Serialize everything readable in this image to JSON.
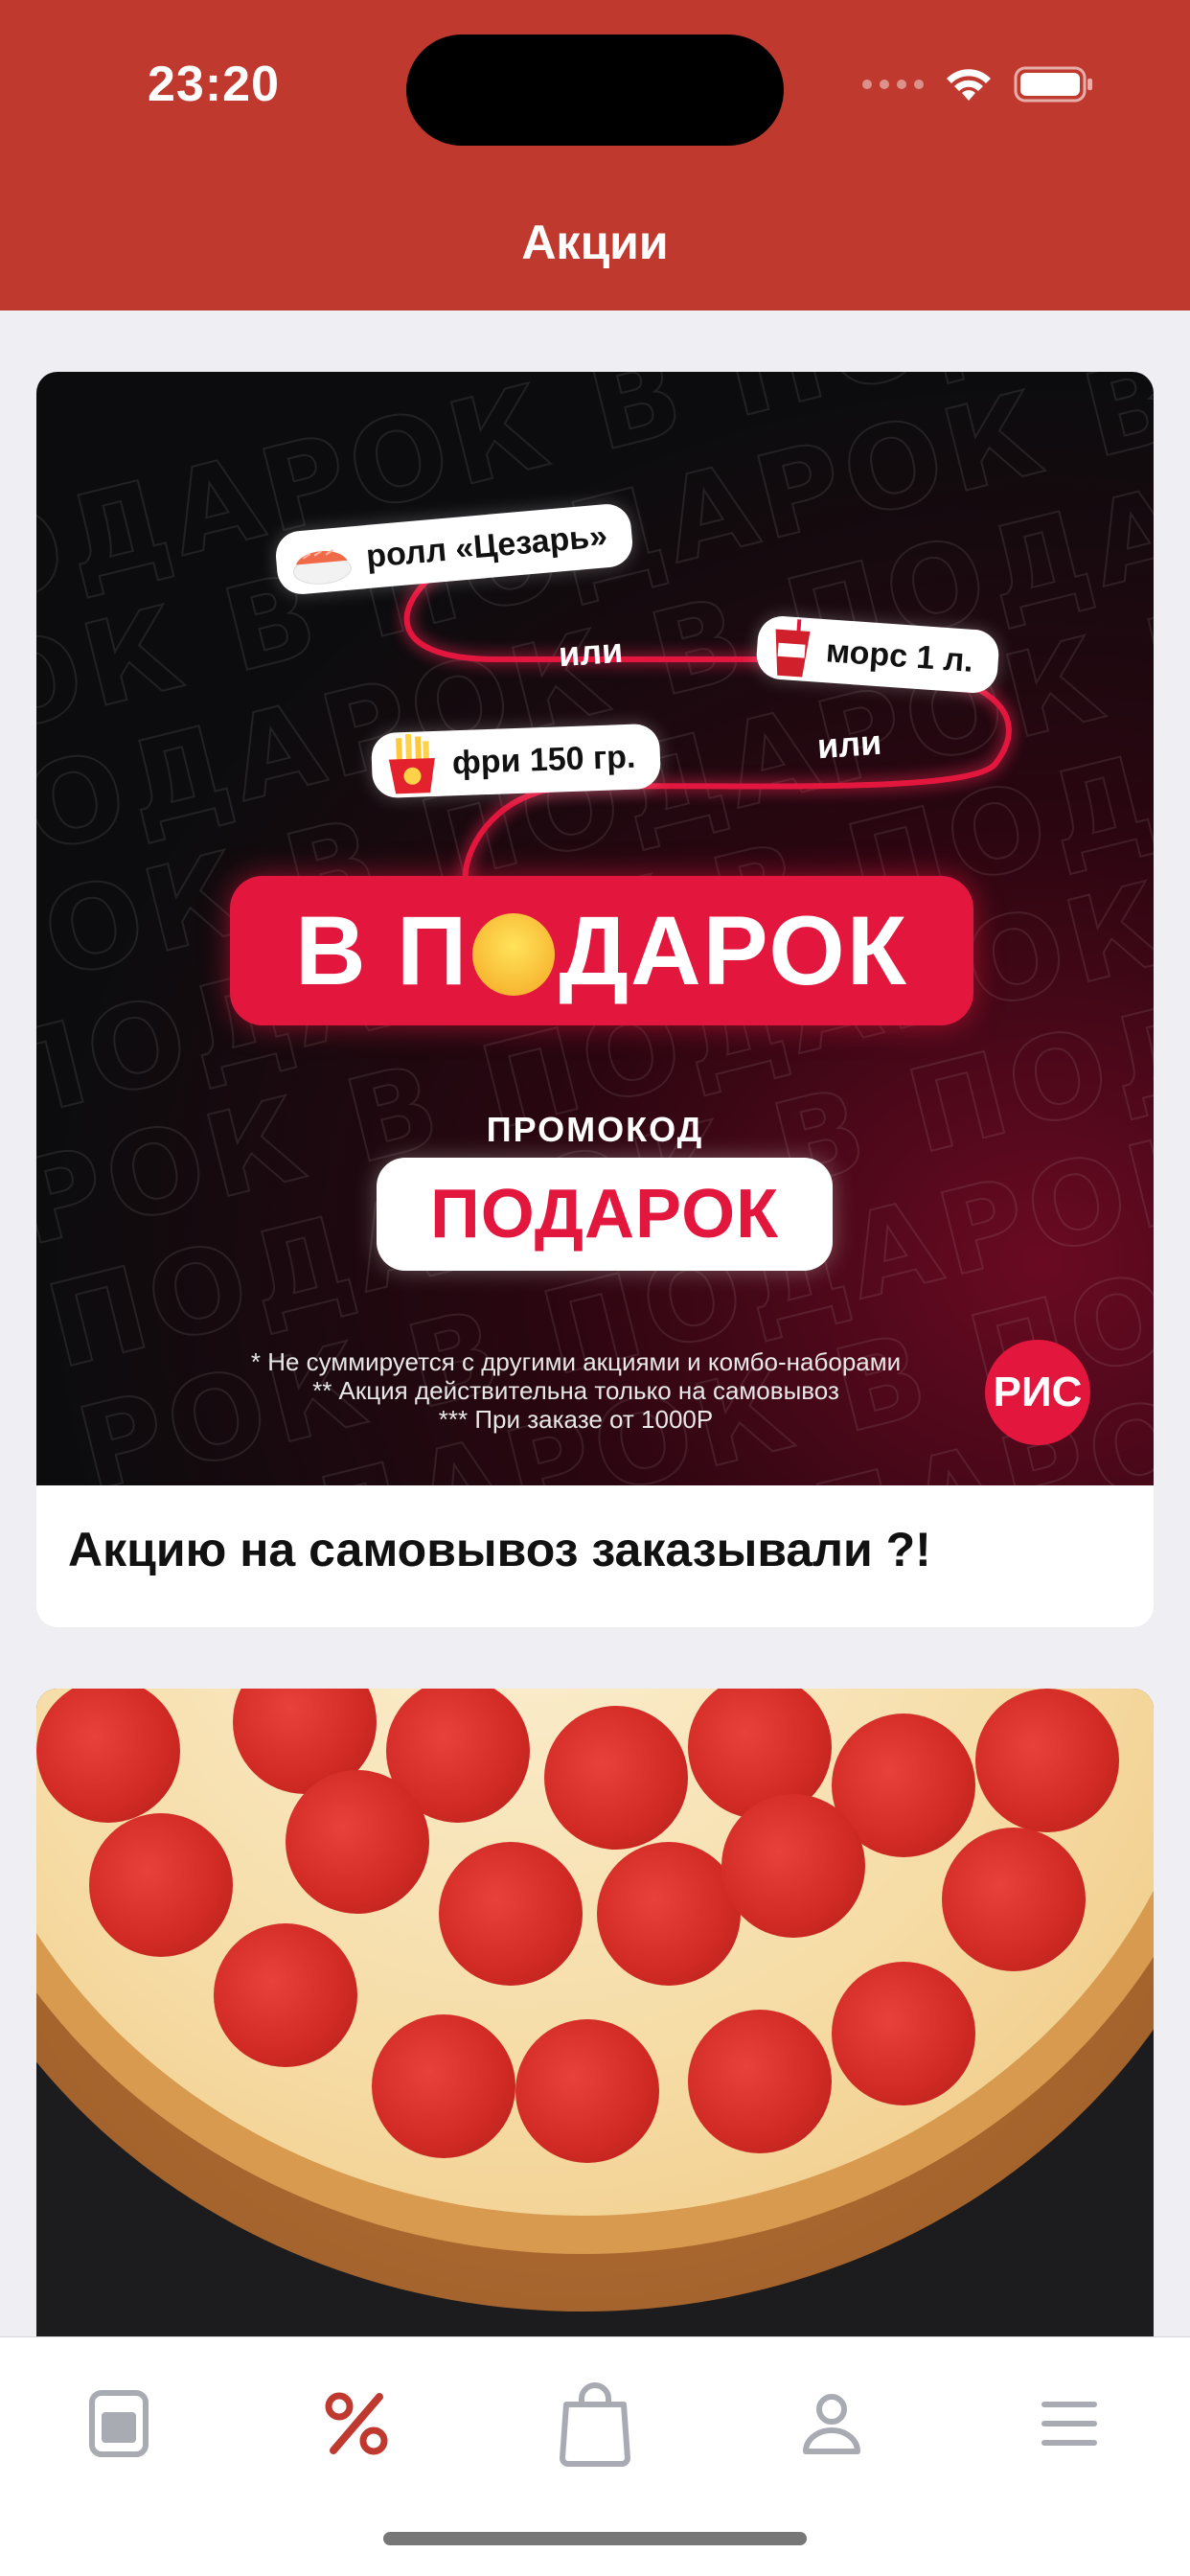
{
  "status_bar": {
    "time": "23:20"
  },
  "header": {
    "title": "Акции"
  },
  "promos": [
    {
      "title": "Акцию на самовывоз заказывали ?!",
      "banner": {
        "background_word": "ПОДАРОК В ",
        "gift_items": [
          "ролл «Цезарь»",
          "морс 1 л.",
          "фри 150 гр."
        ],
        "or_label": "или",
        "headline_left": "В П",
        "headline_right": "ДАРОК",
        "promo_label": "ПРОМОКОД",
        "promo_code": "ПОДАРОК",
        "fine_print": [
          "* Не суммируется с другими акциями и комбо-наборами",
          "** Акция действительна только на самовывоз",
          "*** При заказе от 1000Р"
        ],
        "brand": "РИС"
      }
    },
    {
      "title": ""
    }
  ],
  "tabbar": {
    "active": "promotions",
    "active_color": "#c0392f",
    "inactive_color": "#a9abb3",
    "tabs": [
      {
        "id": "menu",
        "icon": "menu-card-icon"
      },
      {
        "id": "promotions",
        "icon": "percent-icon"
      },
      {
        "id": "cart",
        "icon": "shopping-bag-icon"
      },
      {
        "id": "profile",
        "icon": "person-icon"
      },
      {
        "id": "more",
        "icon": "hamburger-icon"
      }
    ]
  }
}
